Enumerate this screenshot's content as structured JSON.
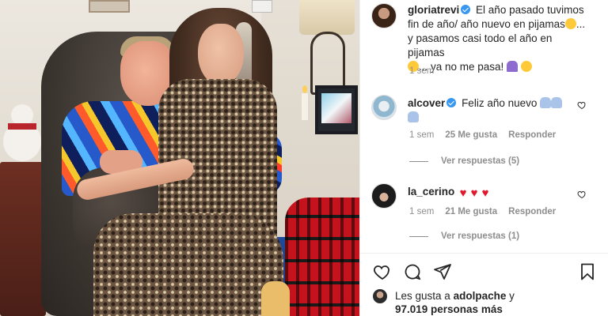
{
  "caption": {
    "username": "gloriatrevi",
    "text_line1": "El año pasado tuvimos",
    "text_line2": "fin de año/ año nuevo en pijamas",
    "text_line2_end": "...",
    "text_line3": "y pasamos casi todo el año en pijamas",
    "text_line4": "... ya no me pasa!",
    "time": "1 sem"
  },
  "comments": [
    {
      "username": "alcover",
      "text": "Feliz año nuevo",
      "time": "1 sem",
      "likes": "25 Me gusta",
      "reply": "Responder",
      "see_replies": "Ver respuestas (5)"
    },
    {
      "username": "la_cerino",
      "text": "",
      "time": "1 sem",
      "likes": "21 Me gusta",
      "reply": "Responder",
      "see_replies": "Ver respuestas (1)"
    }
  ],
  "likes_section": {
    "prefix": "Les gusta a",
    "user": "adolpache",
    "suffix": "y",
    "count": "97.019 personas más"
  },
  "icons": {
    "like": "heart-icon",
    "comment": "comment-icon",
    "share": "paper-plane-icon",
    "save": "bookmark-icon"
  },
  "colors": {
    "verified": "#3897f0",
    "meta_text": "#8e8e8e",
    "heart_emoji": "#e0182d"
  }
}
